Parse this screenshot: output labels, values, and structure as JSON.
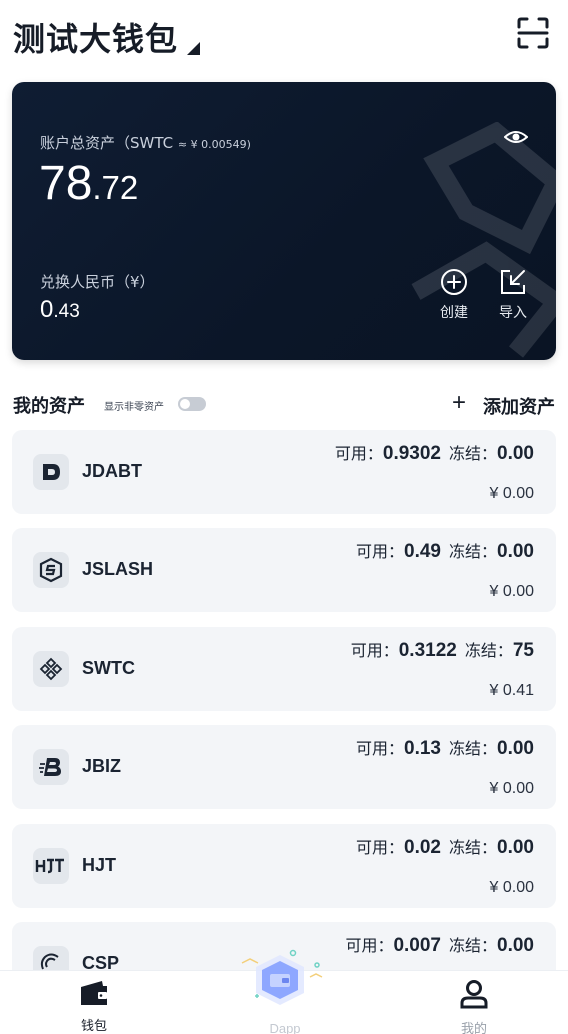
{
  "header": {
    "wallet_name": "测试大钱包",
    "scan_icon": "scan-icon"
  },
  "card": {
    "total_label": "账户总资产（SWTC",
    "rate_text": "≈ ¥ 0.00549)",
    "total_int": "78",
    "total_dec": ".72",
    "cny_label": "兑换人民币（¥）",
    "cny_int": "0",
    "cny_dec": ".43",
    "create_label": "创建",
    "import_label": "导入"
  },
  "assets_section": {
    "title": "我的资产",
    "nonzero_label": "显示非零资产",
    "nonzero_toggle_on": false,
    "add_label": "添加资产"
  },
  "labels": {
    "available": "可用：",
    "frozen": "冻结："
  },
  "assets": [
    {
      "symbol": "JDABT",
      "available": "0.9302",
      "frozen": "0.00",
      "cny": "¥ 0.00",
      "icon": "jdabt-icon"
    },
    {
      "symbol": "JSLASH",
      "available": "0.49",
      "frozen": "0.00",
      "cny": "¥ 0.00",
      "icon": "jslash-icon"
    },
    {
      "symbol": "SWTC",
      "available": "0.3122",
      "frozen": "75",
      "cny": "¥ 0.41",
      "icon": "swtc-icon"
    },
    {
      "symbol": "JBIZ",
      "available": "0.13",
      "frozen": "0.00",
      "cny": "¥ 0.00",
      "icon": "jbiz-icon"
    },
    {
      "symbol": "HJT",
      "available": "0.02",
      "frozen": "0.00",
      "cny": "¥ 0.00",
      "icon": "hjt-icon"
    },
    {
      "symbol": "CSP",
      "available": "0.007",
      "frozen": "0.00",
      "cny": "",
      "icon": "csp-icon"
    }
  ],
  "bottom_nav": {
    "wallet": "钱包",
    "dapp": "Dapp",
    "mine": "我的"
  },
  "colors": {
    "card_bg": "#0f1d33",
    "row_bg": "#f3f5f8",
    "text_dark": "#161c27",
    "nav_inactive": "#9aa1ab"
  }
}
